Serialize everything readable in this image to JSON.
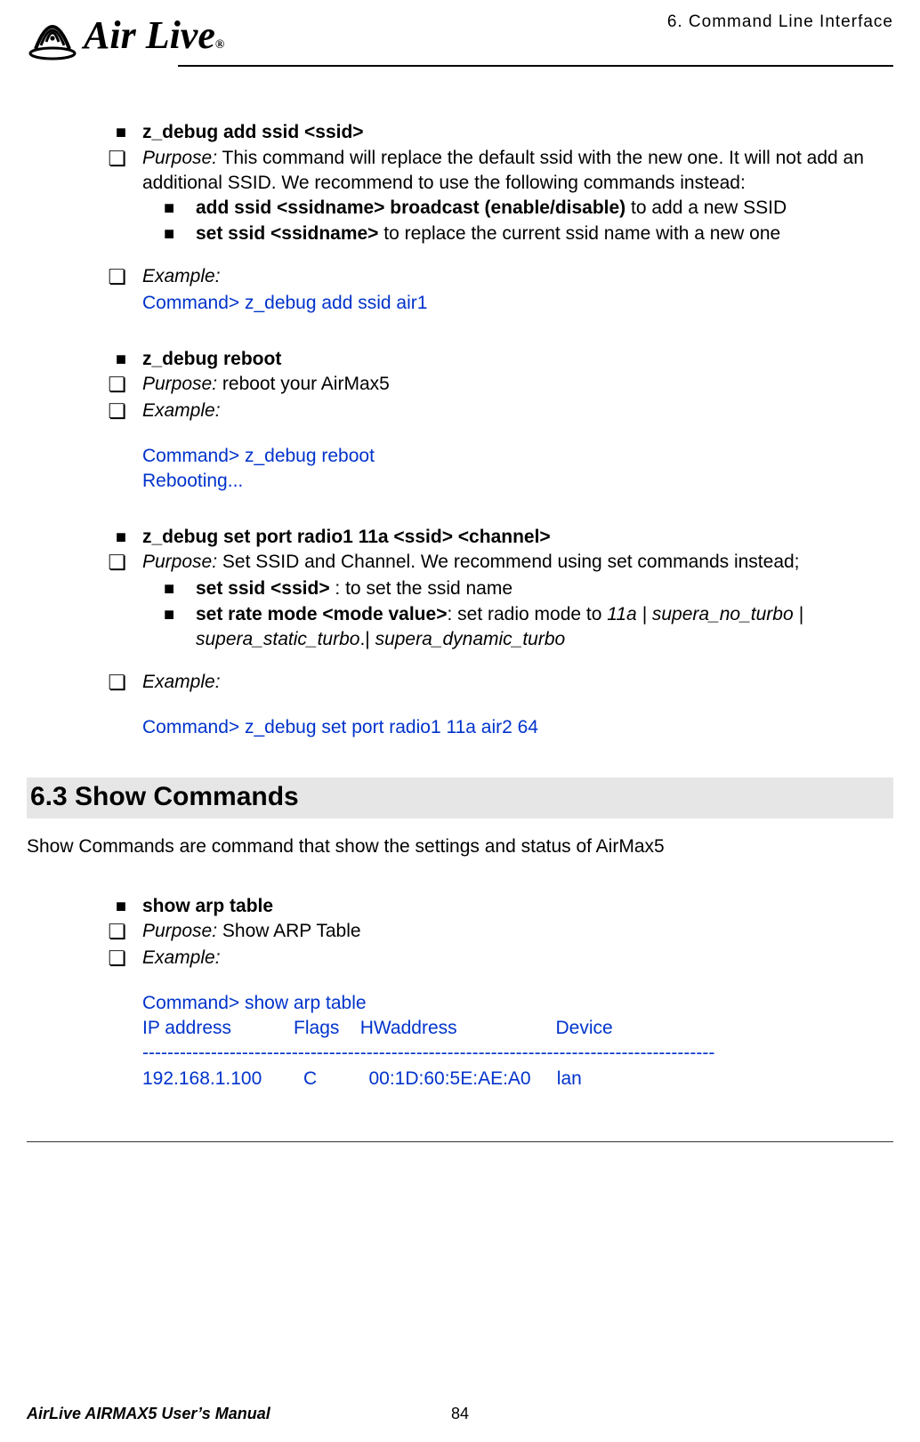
{
  "header": {
    "chapter_label": "6.   Command  Line  Interface",
    "logo_text_main": "Air Live",
    "logo_reg": "®"
  },
  "cmd1": {
    "title": "z_debug add ssid <ssid>",
    "purpose_label": "Purpose:",
    "purpose_text_a": "   This command will replace the default ssid with the new one.   It will not add an additional SSID.   We recommend to use the following commands instead:",
    "sub1_bold": "add ssid <ssidname> broadcast (enable/disable)",
    "sub1_rest": " to add a new SSID",
    "sub2_bold": "set ssid <ssidname>",
    "sub2_rest": " to replace the current ssid name with a new one",
    "example_label": "Example:",
    "example_line": "Command> z_debug add ssid air1"
  },
  "cmd2": {
    "title": "z_debug reboot",
    "purpose_label": "Purpose:",
    "purpose_text": "   reboot your AirMax5",
    "example_label": "Example:",
    "out_line1": "Command> z_debug reboot",
    "out_line2": "Rebooting..."
  },
  "cmd3": {
    "title": "z_debug set port radio1 11a <ssid> <channel>",
    "purpose_label": "Purpose:",
    "purpose_text": "   Set SSID and Channel. We recommend using set commands instead;",
    "sub1_bold": "set ssid <ssid>",
    "sub1_rest": " : to set the ssid name",
    "sub2_bold": "set rate mode <mode value>",
    "sub2_rest_a": ": set radio mode to ",
    "sub2_ital_a": "11a | supera_no_turbo | supera_static_turbo",
    "sub2_rest_b": ".| ",
    "sub2_ital_b": "supera_dynamic_turbo",
    "example_label": "Example:",
    "example_line": "Command> z_debug set port radio1 11a air2 64"
  },
  "section": {
    "heading": "6.3 Show  Commands",
    "intro": "Show Commands are command that show the settings and status of AirMax5"
  },
  "cmd4": {
    "title": "show arp table",
    "purpose_label": "Purpose:",
    "purpose_text": " Show ARP Table",
    "example_label": "Example:",
    "out1": "Command> show arp table",
    "out2": "IP address            Flags    HWaddress                   Device",
    "out3": "--------------------------------------------------------------------------------------------",
    "out4": "192.168.1.100        C          00:1D:60:5E:AE:A0     lan"
  },
  "footer": {
    "left": "AirLive AIRMAX5 User’s Manual",
    "page": "84"
  }
}
